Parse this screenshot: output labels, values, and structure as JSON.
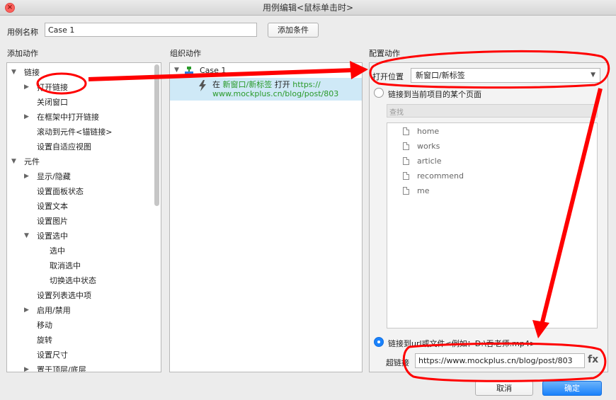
{
  "window": {
    "title": "用例编辑<鼠标单击时>"
  },
  "case_name": {
    "label": "用例名称",
    "value": "Case 1",
    "add_condition": "添加条件"
  },
  "sections": {
    "add_action": "添加动作",
    "organize_action": "组织动作",
    "config_action": "配置动作"
  },
  "action_tree": [
    {
      "label": "链接",
      "level": 0,
      "toggle": "open"
    },
    {
      "label": "打开链接",
      "level": 1,
      "toggle": "closed"
    },
    {
      "label": "关闭窗口",
      "level": 1,
      "toggle": "none"
    },
    {
      "label": "在框架中打开链接",
      "level": 1,
      "toggle": "closed"
    },
    {
      "label": "滚动到元件<锚链接>",
      "level": 1,
      "toggle": "none"
    },
    {
      "label": "设置自适应视图",
      "level": 1,
      "toggle": "none"
    },
    {
      "label": "元件",
      "level": 0,
      "toggle": "open"
    },
    {
      "label": "显示/隐藏",
      "level": 1,
      "toggle": "closed"
    },
    {
      "label": "设置面板状态",
      "level": 1,
      "toggle": "none"
    },
    {
      "label": "设置文本",
      "level": 1,
      "toggle": "none"
    },
    {
      "label": "设置图片",
      "level": 1,
      "toggle": "none"
    },
    {
      "label": "设置选中",
      "level": 1,
      "toggle": "open"
    },
    {
      "label": "选中",
      "level": 2,
      "toggle": "none"
    },
    {
      "label": "取消选中",
      "level": 2,
      "toggle": "none"
    },
    {
      "label": "切换选中状态",
      "level": 2,
      "toggle": "none"
    },
    {
      "label": "设置列表选中项",
      "level": 1,
      "toggle": "none"
    },
    {
      "label": "启用/禁用",
      "level": 1,
      "toggle": "closed"
    },
    {
      "label": "移动",
      "level": 1,
      "toggle": "none"
    },
    {
      "label": "旋转",
      "level": 1,
      "toggle": "none"
    },
    {
      "label": "设置尺寸",
      "level": 1,
      "toggle": "none"
    },
    {
      "label": "置于顶层/底层",
      "level": 1,
      "toggle": "closed"
    }
  ],
  "organize": {
    "case_label": "Case 1",
    "action_prefix": "在",
    "action_target": "新窗口/新标签",
    "action_verb": "打开",
    "action_url_part1": "https://",
    "action_url_part2": "www.mockplus.cn/blog/post/803"
  },
  "config": {
    "open_location_label": "打开位置",
    "open_location_value": "新窗口/新标签",
    "link_page_label": "链接到当前项目的某个页面",
    "search_placeholder": "查找",
    "pages": [
      "home",
      "works",
      "article",
      "recommend",
      "me"
    ],
    "link_url_label": "链接到url或文件<例如：D:\\吞老师.mp4>",
    "hyperlink_label": "超链接",
    "hyperlink_value": "https://www.mockplus.cn/blog/post/803",
    "fx_label": "fx"
  },
  "footer": {
    "cancel": "取消",
    "confirm": "确定"
  },
  "colors": {
    "accent": "#1a82fb",
    "highlight_row": "#cfe9f7",
    "annotation_red": "#ff0000",
    "action_green": "#2a9a2a"
  },
  "icons": [
    "close-icon",
    "case-icon",
    "lightning-icon",
    "document-icon",
    "chevron-down-icon",
    "triangle-right-icon",
    "triangle-down-icon"
  ]
}
